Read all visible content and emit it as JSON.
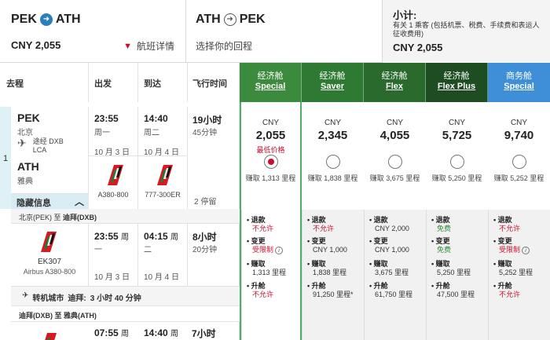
{
  "outbound": {
    "from": "PEK",
    "to": "ATH",
    "price": "CNY 2,055",
    "details_label": "航班详情"
  },
  "return": {
    "from": "ATH",
    "to": "PEK",
    "hint": "选择你的回程"
  },
  "subtotal": {
    "title": "小计:",
    "note": "有关 1 乘客 (包括机票、税费、手续费和表运人征收费用)",
    "total": "CNY 2,055"
  },
  "headers": {
    "route": "去程",
    "depart": "出发",
    "arrive": "到达",
    "duration": "飞行时间"
  },
  "cabins": [
    {
      "cn": "经济舱",
      "en": "Special",
      "color": "#3c8a3e"
    },
    {
      "cn": "经济舱",
      "en": "Saver",
      "color": "#2f7a33"
    },
    {
      "cn": "经济舱",
      "en": "Flex",
      "color": "#2a6a2d"
    },
    {
      "cn": "经济舱",
      "en": "Flex Plus",
      "color": "#1d4d21"
    },
    {
      "cn": "商务舱",
      "en": "Special",
      "color": "#3e8fd8"
    }
  ],
  "flight": {
    "index": "1",
    "origin": "PEK",
    "origin_city": "北京",
    "via_label": "途经 DXB",
    "via_code2": "LCA",
    "dest": "ATH",
    "dest_city": "雅典",
    "dep_time": "23:55",
    "dep_weekday": "周一",
    "dep_date": "10 月 3 日",
    "arr_time": "14:40",
    "arr_weekday": "周二",
    "arr_date": "10 月 4 日",
    "duration_h": "19小时",
    "duration_m": "45分钟",
    "aircraft1": "A380-800",
    "aircraft2": "777-300ER",
    "stops": "2 停留",
    "hide_label": "隐藏信息"
  },
  "leg1": {
    "header_from": "北京(PEK) 至 ",
    "header_to": "迪拜(DXB)",
    "flight_no": "EK307",
    "aircraft": "Airbus A380-800",
    "dep_time": "23:55",
    "dep_wd": "周",
    "dep_wd2": "一",
    "dep_date": "10 月 3 日",
    "arr_time": "04:15",
    "arr_wd": "周",
    "arr_wd2": "二",
    "arr_date": "10 月 4 日",
    "dur_h": "8小时",
    "dur_m": "20分钟"
  },
  "connection": {
    "label": "转机城市",
    "city": "迪拜:",
    "time": "3 小时 40 分钟"
  },
  "leg2": {
    "header": "迪拜(DXB) 至 雅典(ATH)",
    "dep_time": "07:55",
    "dep_wd": "周",
    "arr_time": "14:40",
    "arr_wd": "周",
    "dur_h": "7小时"
  },
  "fares": [
    {
      "currency": "CNY",
      "amount": "2,055",
      "lowest": "最低价格",
      "selected": true,
      "earn": "赚取 1,313 里程",
      "refund_label": "退款",
      "refund": "不允许",
      "refund_style": "red",
      "change_label": "变更",
      "change": "受限制",
      "change_style": "red",
      "miles_label": "赚取",
      "miles": "1,313 里程",
      "upgrade_label": "升舱",
      "upgrade": "不允许",
      "upgrade_style": "red"
    },
    {
      "currency": "CNY",
      "amount": "2,345",
      "lowest": "",
      "selected": false,
      "earn": "赚取 1,838 里程",
      "refund_label": "退款",
      "refund": "不允许",
      "refund_style": "red",
      "change_label": "变更",
      "change": "CNY 1,000",
      "change_style": "",
      "miles_label": "赚取",
      "miles": "1,838 里程",
      "upgrade_label": "升舱",
      "upgrade": "91,250 里程*",
      "upgrade_style": ""
    },
    {
      "currency": "CNY",
      "amount": "4,055",
      "lowest": "",
      "selected": false,
      "earn": "赚取 3,675 里程",
      "refund_label": "退款",
      "refund": "CNY 2,000",
      "refund_style": "",
      "change_label": "变更",
      "change": "CNY 1,000",
      "change_style": "",
      "miles_label": "赚取",
      "miles": "3,675 里程",
      "upgrade_label": "升舱",
      "upgrade": "61,750 里程",
      "upgrade_style": ""
    },
    {
      "currency": "CNY",
      "amount": "5,725",
      "lowest": "",
      "selected": false,
      "earn": "赚取 5,250 里程",
      "refund_label": "退款",
      "refund": "免费",
      "refund_style": "green",
      "change_label": "变更",
      "change": "免费",
      "change_style": "green",
      "miles_label": "赚取",
      "miles": "5,250 里程",
      "upgrade_label": "升舱",
      "upgrade": "47,500 里程",
      "upgrade_style": ""
    },
    {
      "currency": "CNY",
      "amount": "9,740",
      "lowest": "",
      "selected": false,
      "earn": "赚取 5,252 里程",
      "refund_label": "退款",
      "refund": "不允许",
      "refund_style": "red",
      "change_label": "变更",
      "change": "受限制",
      "change_style": "red",
      "miles_label": "赚取",
      "miles": "5,252 里程",
      "upgrade_label": "升舱",
      "upgrade": "不允许",
      "upgrade_style": "red"
    }
  ]
}
